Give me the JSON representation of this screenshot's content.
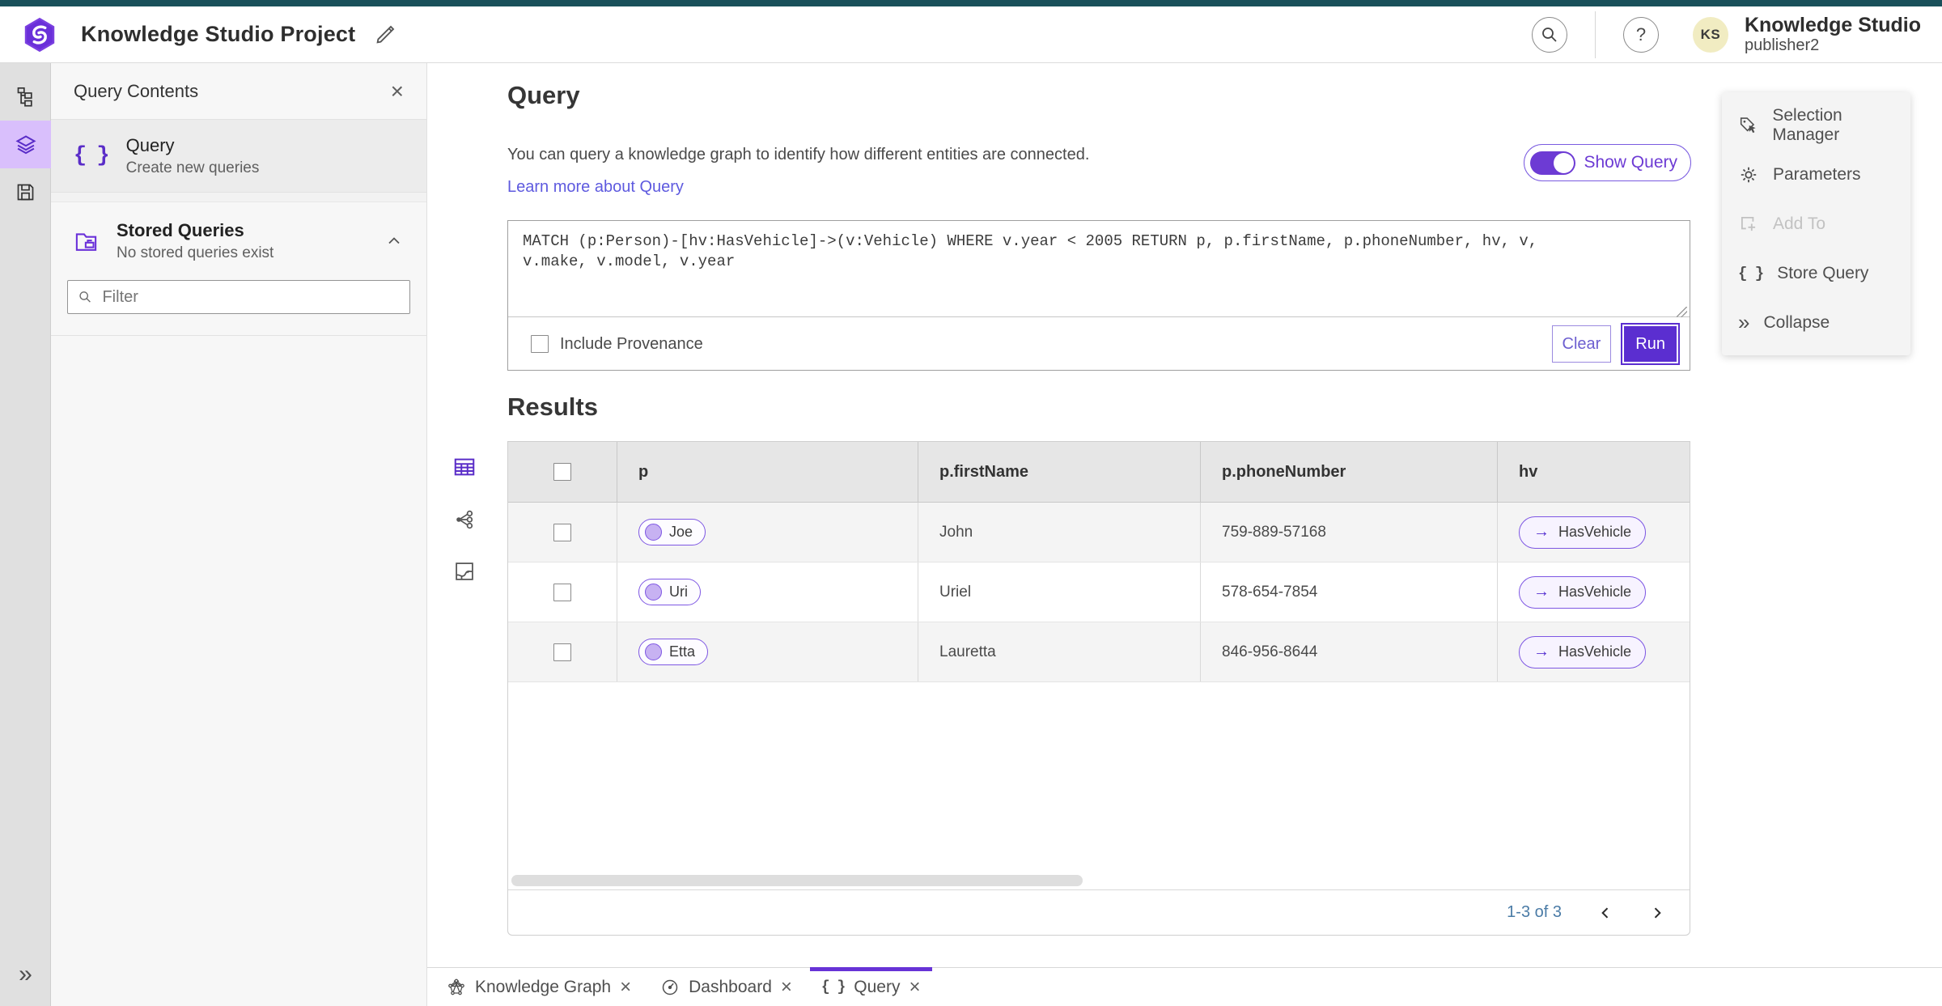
{
  "colors": {
    "brand_purple": "#5b2ed0",
    "accent_teal": "#1a505a",
    "light_purple": "#d9bffc",
    "link_blue_violet": "#5e5adf"
  },
  "header": {
    "project_title": "Knowledge Studio Project",
    "app_name": "Knowledge Studio",
    "user_name": "publisher2",
    "avatar_initials": "KS"
  },
  "rail": {
    "items": [
      {
        "icon": "data-model-icon"
      },
      {
        "icon": "layers-icon",
        "active": true
      },
      {
        "icon": "save-icon"
      }
    ],
    "expand_icon": "double-chevron-right-icon"
  },
  "contents_panel": {
    "title": "Query Contents",
    "query_item": {
      "label": "Query",
      "description": "Create new queries",
      "icon": "braces-icon"
    },
    "stored_queries": {
      "label": "Stored Queries",
      "description": "No stored queries exist",
      "icon": "folder-icon",
      "state_icon": "chevron-up-icon"
    },
    "filter_placeholder": "Filter"
  },
  "query_section": {
    "title": "Query",
    "description": "You can query a knowledge graph to identify how different entities are connected.",
    "learn_more_label": "Learn more about Query",
    "show_query_label": "Show Query",
    "show_query_on": true,
    "query_text": "MATCH (p:Person)-[hv:HasVehicle]->(v:Vehicle) WHERE v.year < 2005 RETURN p, p.firstName, p.phoneNumber, hv, v,\nv.make, v.model, v.year",
    "include_provenance_label": "Include Provenance",
    "include_provenance_checked": false,
    "clear_label": "Clear",
    "run_label": "Run"
  },
  "tools_menu": {
    "items": [
      {
        "label": "Selection Manager",
        "icon": "selection-manager-icon",
        "disabled": false
      },
      {
        "label": "Parameters",
        "icon": "gear-icon",
        "disabled": false
      },
      {
        "label": "Add To",
        "icon": "add-to-icon",
        "disabled": true
      },
      {
        "label": "Store Query",
        "icon": "braces-icon",
        "disabled": false
      },
      {
        "label": "Collapse",
        "icon": "double-chevron-right-icon",
        "disabled": false
      }
    ]
  },
  "results": {
    "title": "Results",
    "view_switcher": [
      "table-view",
      "graph-view",
      "map-view"
    ],
    "columns": [
      "p",
      "p.firstName",
      "p.phoneNumber",
      "hv"
    ],
    "rows": [
      {
        "p": "Joe",
        "firstName": "John",
        "phoneNumber": "759-889-57168",
        "hv": "HasVehicle"
      },
      {
        "p": "Uri",
        "firstName": "Uriel",
        "phoneNumber": "578-654-7854",
        "hv": "HasVehicle"
      },
      {
        "p": "Etta",
        "firstName": "Lauretta",
        "phoneNumber": "846-956-8644",
        "hv": "HasVehicle"
      }
    ],
    "pagination": "1-3 of 3"
  },
  "tabs": [
    {
      "label": "Knowledge Graph",
      "icon": "knowledge-graph-icon",
      "active": false
    },
    {
      "label": "Dashboard",
      "icon": "dashboard-icon",
      "active": false
    },
    {
      "label": "Query",
      "icon": "braces-icon",
      "active": true
    }
  ]
}
